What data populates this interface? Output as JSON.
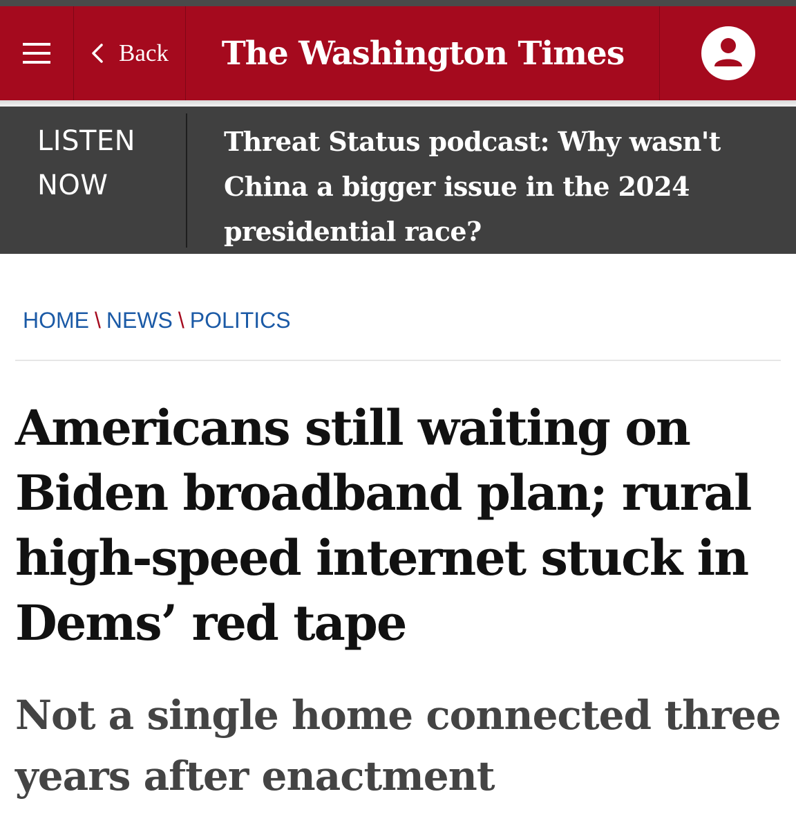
{
  "header": {
    "back_label": "Back",
    "logo_text": "The Washington Times",
    "brand_color": "#a50a1e",
    "icons": {
      "menu": "hamburger-menu-icon",
      "back": "chevron-left-icon",
      "account": "user-account-icon"
    }
  },
  "listen_bar": {
    "label": "LISTEN NOW",
    "headline": "Threat Status podcast: Why wasn't China a bigger issue in the 2024 presidential race?"
  },
  "breadcrumb": {
    "items": [
      "HOME",
      "NEWS",
      "POLITICS"
    ],
    "separator": "\\"
  },
  "article": {
    "headline": "Americans still waiting on Biden broadband plan; rural high-speed internet stuck in Dems’ red tape",
    "subheadline": "Not a single home connected three years after enactment"
  }
}
